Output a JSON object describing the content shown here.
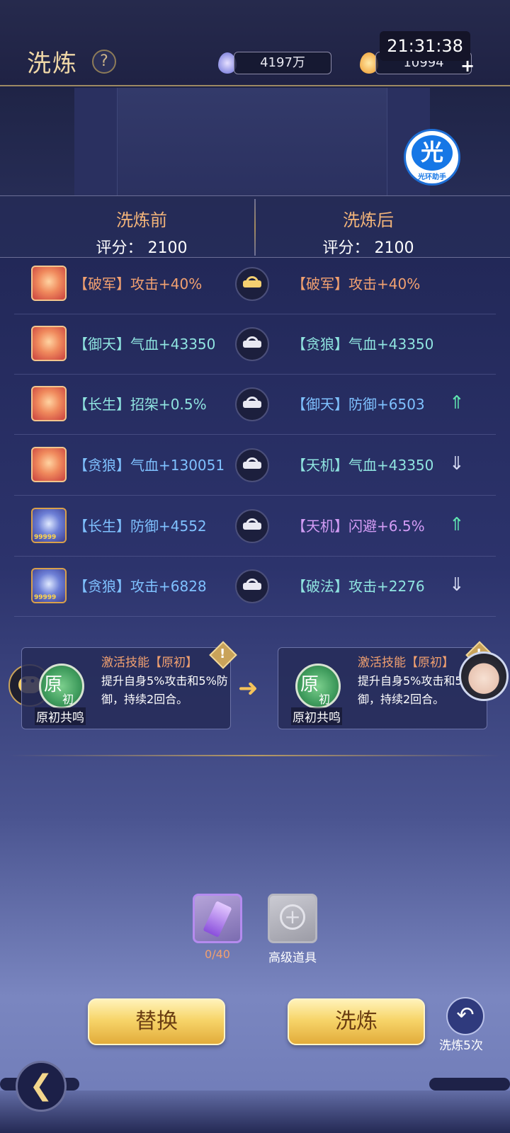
{
  "header": {
    "title": "洗炼",
    "help": "?",
    "clock": "21:31:38",
    "currency_1": "4197万",
    "currency_2": "10994",
    "plus": "+"
  },
  "badge": {
    "glyph": "光",
    "label": "光环助手"
  },
  "compare": {
    "before_title": "洗炼前",
    "before_score": "评分：  2100",
    "after_title": "洗炼后",
    "after_score": "评分：  2100"
  },
  "rows": [
    {
      "before": "【破军】攻击+40%",
      "before_color": "orange",
      "after": "【破军】攻击+40%",
      "after_color": "orange",
      "locked": true,
      "trend": ""
    },
    {
      "before": "【御天】气血+43350",
      "before_color": "teal",
      "after": "【贪狼】气血+43350",
      "after_color": "teal",
      "locked": false,
      "trend": ""
    },
    {
      "before": "【长生】招架+0.5%",
      "before_color": "teal",
      "after": "【御天】防御+6503",
      "after_color": "blue",
      "locked": false,
      "trend": "up"
    },
    {
      "before": "【贪狼】气血+130051",
      "before_color": "blue",
      "after": "【天机】气血+43350",
      "after_color": "teal",
      "locked": false,
      "trend": "down"
    },
    {
      "before": "【长生】防御+4552",
      "before_color": "blue",
      "after": "【天机】闪避+6.5%",
      "after_color": "purple",
      "locked": false,
      "trend": "up"
    },
    {
      "before": "【贪狼】攻击+6828",
      "before_color": "blue",
      "after": "【破法】攻击+2276",
      "after_color": "teal",
      "locked": false,
      "trend": "down"
    }
  ],
  "gem_level_label": "99999",
  "skills": {
    "before": {
      "icon_main": "原",
      "icon_sub": "初",
      "label": "原初共鸣",
      "name": "激活技能【原初】",
      "desc": "提升自身5%攻击和5%防御，持续2回合。"
    },
    "after": {
      "icon_main": "原",
      "icon_sub": "初",
      "label": "原初共鸣",
      "name": "激活技能【原初】",
      "desc": "提升自身5%攻击和5%防御，持续2回合。"
    }
  },
  "items": {
    "crystal_count": "0/40",
    "slot_label": "高级道具"
  },
  "actions": {
    "replace": "替换",
    "refine": "洗炼",
    "refine_five": "洗炼5次"
  },
  "colors": {
    "orange": "#f1a070",
    "teal": "#8fe4e0",
    "blue": "#7fc1ff",
    "purple": "#d39cf5",
    "accent_gold": "#f7d56a"
  }
}
